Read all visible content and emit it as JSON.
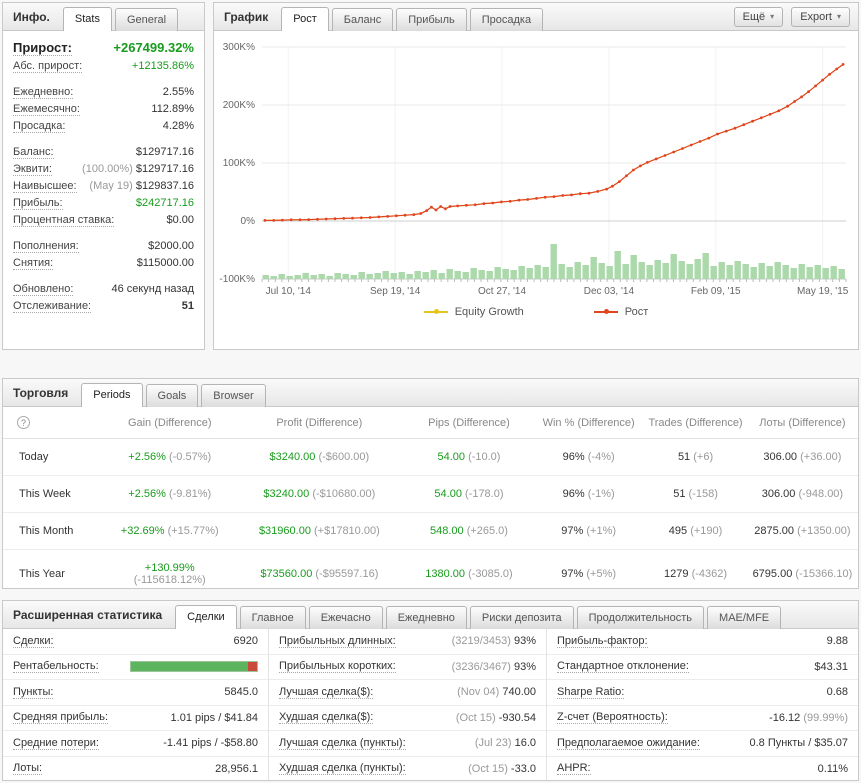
{
  "info_panel": {
    "title": "Инфо.",
    "tabs": [
      "Stats",
      "General"
    ],
    "rows": [
      {
        "label": "Прирост:",
        "value": "+267499.32%"
      },
      {
        "label": "Абс. прирост:",
        "value": "+12135.86%"
      },
      {
        "label": "Ежедневно:",
        "value": "2.55%"
      },
      {
        "label": "Ежемесячно:",
        "value": "112.89%"
      },
      {
        "label": "Просадка:",
        "value": "4.28%"
      },
      {
        "label": "Баланс:",
        "value": "$129717.16"
      },
      {
        "label": "Эквити:",
        "pre": "(100.00%)",
        "value": "$129717.16"
      },
      {
        "label": "Наивысшее:",
        "pre": "(May 19)",
        "value": "$129837.16"
      },
      {
        "label": "Прибыль:",
        "value": "$242717.16"
      },
      {
        "label": "Процентная ставка:",
        "value": "$0.00"
      },
      {
        "label": "Пополнения:",
        "value": "$2000.00"
      },
      {
        "label": "Снятия:",
        "value": "$115000.00"
      },
      {
        "label": "Обновлено:",
        "value": "46 секунд назад"
      },
      {
        "label": "Отслеживание:",
        "value": "51"
      }
    ]
  },
  "chart_panel": {
    "title": "График",
    "tabs": [
      "Рост",
      "Баланс",
      "Прибыль",
      "Просадка"
    ],
    "more_button": {
      "label": "Ещё",
      "icon": "▾"
    },
    "export_button": {
      "label": "Export",
      "icon": "▾"
    }
  },
  "chart_data": {
    "type": "line",
    "title": "Рост",
    "unit": "K%",
    "ylim": [
      -100,
      300
    ],
    "yticks": [
      "300K%",
      "200K%",
      "100K%",
      "0%",
      "-100K%"
    ],
    "xticks": [
      "Jul 10, '14",
      "Sep 19, '14",
      "Oct 27, '14",
      "Dec 03, '14",
      "Feb 09, '15",
      "May 19, '15"
    ],
    "series": [
      {
        "name": "Equity Growth",
        "color": "#e6c41d"
      },
      {
        "name": "Рост",
        "color": "#e0451f"
      }
    ],
    "growth_points": [
      [
        0.005,
        1
      ],
      [
        0.02,
        1
      ],
      [
        0.035,
        1.5
      ],
      [
        0.05,
        2
      ],
      [
        0.065,
        2
      ],
      [
        0.08,
        2.5
      ],
      [
        0.095,
        3
      ],
      [
        0.11,
        3.5
      ],
      [
        0.125,
        4
      ],
      [
        0.14,
        4.5
      ],
      [
        0.155,
        5
      ],
      [
        0.17,
        5.5
      ],
      [
        0.185,
        6
      ],
      [
        0.2,
        7
      ],
      [
        0.215,
        8
      ],
      [
        0.23,
        9
      ],
      [
        0.245,
        10
      ],
      [
        0.26,
        11
      ],
      [
        0.272,
        13
      ],
      [
        0.282,
        18
      ],
      [
        0.29,
        24
      ],
      [
        0.298,
        19
      ],
      [
        0.306,
        25
      ],
      [
        0.314,
        21
      ],
      [
        0.322,
        25
      ],
      [
        0.335,
        26
      ],
      [
        0.35,
        27
      ],
      [
        0.365,
        28
      ],
      [
        0.38,
        30
      ],
      [
        0.395,
        31
      ],
      [
        0.41,
        33
      ],
      [
        0.425,
        34
      ],
      [
        0.44,
        36
      ],
      [
        0.455,
        37
      ],
      [
        0.47,
        39
      ],
      [
        0.485,
        41
      ],
      [
        0.5,
        42
      ],
      [
        0.515,
        44
      ],
      [
        0.53,
        45
      ],
      [
        0.545,
        47
      ],
      [
        0.56,
        48
      ],
      [
        0.575,
        51
      ],
      [
        0.59,
        55
      ],
      [
        0.6,
        60
      ],
      [
        0.612,
        68
      ],
      [
        0.624,
        78
      ],
      [
        0.636,
        88
      ],
      [
        0.648,
        95
      ],
      [
        0.66,
        101
      ],
      [
        0.675,
        107
      ],
      [
        0.69,
        113
      ],
      [
        0.705,
        119
      ],
      [
        0.72,
        125
      ],
      [
        0.735,
        131
      ],
      [
        0.75,
        137
      ],
      [
        0.765,
        143
      ],
      [
        0.78,
        150
      ],
      [
        0.795,
        155
      ],
      [
        0.81,
        160
      ],
      [
        0.825,
        166
      ],
      [
        0.84,
        172
      ],
      [
        0.855,
        178
      ],
      [
        0.87,
        184
      ],
      [
        0.885,
        190
      ],
      [
        0.9,
        198
      ],
      [
        0.912,
        206
      ],
      [
        0.924,
        214
      ],
      [
        0.936,
        223
      ],
      [
        0.948,
        233
      ],
      [
        0.96,
        243
      ],
      [
        0.972,
        253
      ],
      [
        0.984,
        262
      ],
      [
        0.995,
        270
      ]
    ],
    "volume_color": "#abd9ab",
    "volume": [
      4,
      3,
      5,
      3,
      4,
      6,
      4,
      5,
      3,
      6,
      5,
      4,
      7,
      5,
      6,
      8,
      6,
      7,
      5,
      8,
      7,
      9,
      6,
      10,
      8,
      7,
      11,
      9,
      8,
      12,
      10,
      9,
      13,
      11,
      14,
      12,
      35,
      15,
      12,
      17,
      14,
      22,
      16,
      13,
      28,
      15,
      24,
      17,
      14,
      19,
      16,
      25,
      18,
      15,
      20,
      26,
      13,
      17,
      14,
      18,
      15,
      12,
      16,
      13,
      17,
      14,
      11,
      15,
      12,
      14,
      11,
      13,
      10
    ]
  },
  "trade_panel": {
    "title": "Торговля",
    "tabs": [
      "Periods",
      "Goals",
      "Browser"
    ],
    "help_icon": "?",
    "columns": [
      "Gain (Difference)",
      "Profit (Difference)",
      "Pips (Difference)",
      "Win % (Difference)",
      "Trades (Difference)",
      "Лоты (Difference)"
    ],
    "rows": [
      {
        "period": "Today",
        "gain": "+2.56%",
        "gain_diff": "(-0.57%)",
        "profit": "$3240.00",
        "profit_diff": "(-$600.00)",
        "pips": "54.00",
        "pips_diff": "(-10.0)",
        "win": "96%",
        "win_diff": "(-4%)",
        "trades": "51",
        "trades_diff": "(+6)",
        "lots": "306.00",
        "lots_diff": "(+36.00)"
      },
      {
        "period": "This Week",
        "gain": "+2.56%",
        "gain_diff": "(-9.81%)",
        "profit": "$3240.00",
        "profit_diff": "(-$10680.00)",
        "pips": "54.00",
        "pips_diff": "(-178.0)",
        "win": "96%",
        "win_diff": "(-1%)",
        "trades": "51",
        "trades_diff": "(-158)",
        "lots": "306.00",
        "lots_diff": "(-948.00)"
      },
      {
        "period": "This Month",
        "gain": "+32.69%",
        "gain_diff": "(+15.77%)",
        "profit": "$31960.00",
        "profit_diff": "(+$17810.00)",
        "pips": "548.00",
        "pips_diff": "(+265.0)",
        "win": "97%",
        "win_diff": "(+1%)",
        "trades": "495",
        "trades_diff": "(+190)",
        "lots": "2875.00",
        "lots_diff": "(+1350.00)"
      },
      {
        "period": "This Year",
        "gain": "+130.99%",
        "gain_diff": "(-115618.12%)",
        "profit": "$73560.00",
        "profit_diff": "(-$95597.16)",
        "pips": "1380.00",
        "pips_diff": "(-3085.0)",
        "win": "97%",
        "win_diff": "(+5%)",
        "trades": "1279",
        "trades_diff": "(-4362)",
        "lots": "6795.00",
        "lots_diff": "(-15366.10)"
      }
    ]
  },
  "stats_panel": {
    "title": "Расширенная статистика",
    "tabs": [
      "Сделки",
      "Главное",
      "Ежечасно",
      "Ежедневно",
      "Риски депозита",
      "Продолжительность",
      "MAE/MFE"
    ],
    "col1": [
      {
        "label": "Сделки:",
        "value": "6920"
      },
      {
        "label": "Рентабельность:",
        "bar": {
          "green_pct": 93,
          "red_pct": 7,
          "green_color": "#5cb55e",
          "red_color": "#c94a3c"
        }
      },
      {
        "label": "Пункты:",
        "value": "5845.0"
      },
      {
        "label": "Средняя прибыль:",
        "value": "1.01 pips / $41.84"
      },
      {
        "label": "Средние потери:",
        "value": "-1.41 pips / -$58.80"
      },
      {
        "label": "Лоты:",
        "value": "28,956.1"
      }
    ],
    "col2": [
      {
        "label": "Прибыльных длинных:",
        "pre": "(3219/3453)",
        "value": "93%"
      },
      {
        "label": "Прибыльных коротких:",
        "pre": "(3236/3467)",
        "value": "93%"
      },
      {
        "label": "Лучшая сделка($):",
        "pre": "(Nov 04)",
        "value": "740.00"
      },
      {
        "label": "Худшая сделка($):",
        "pre": "(Oct 15)",
        "value": "-930.54"
      },
      {
        "label": "Лучшая сделка (пункты):",
        "pre": "(Jul 23)",
        "value": "16.0"
      },
      {
        "label": "Худшая сделка (пункты):",
        "pre": "(Oct 15)",
        "value": "-33.0"
      }
    ],
    "col3": [
      {
        "label": "Прибыль-фактор:",
        "value": "9.88"
      },
      {
        "label": "Стандартное отклонение:",
        "value": "$43.31"
      },
      {
        "label": "Sharpe Ratio:",
        "value": "0.68"
      },
      {
        "label": "Z-счет (Вероятность):",
        "value": "-16.12",
        "post": "(99.99%)"
      },
      {
        "label": "Предполагаемое ожидание:",
        "value": "0.8 Пункты / $35.07"
      },
      {
        "label": "AHPR:",
        "value": "0.11%"
      }
    ]
  }
}
